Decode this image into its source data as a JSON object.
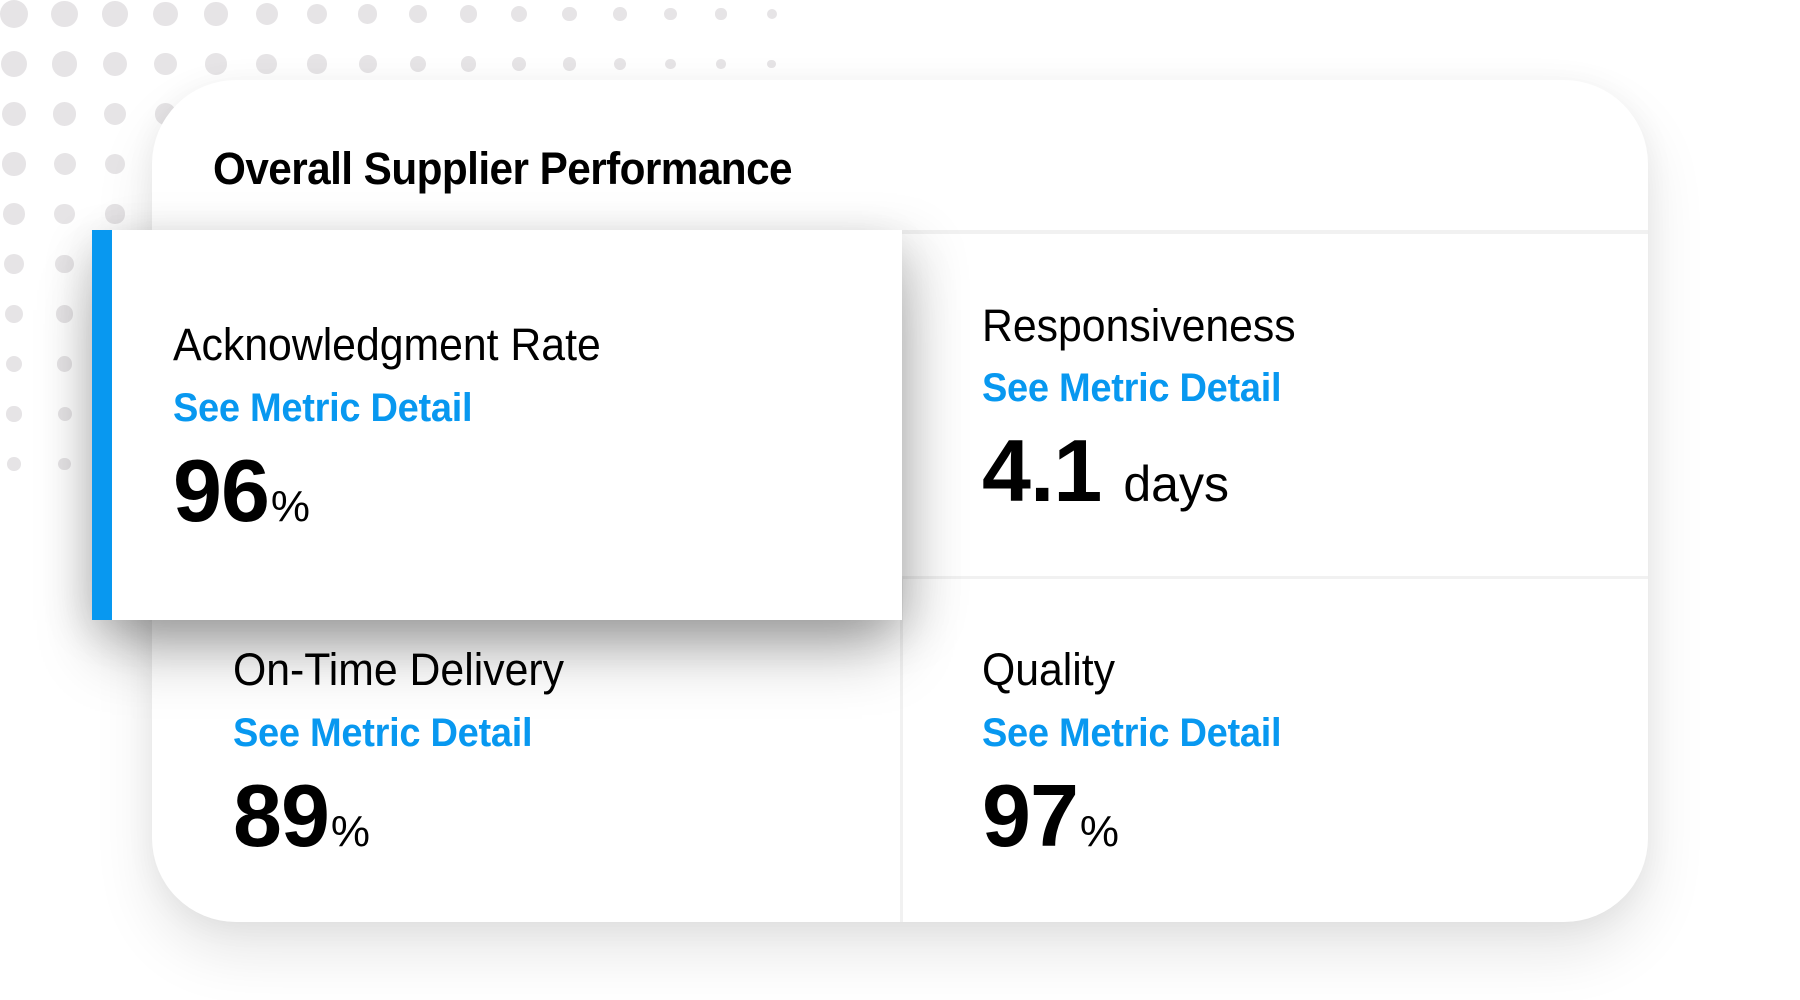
{
  "colors": {
    "accent": "#0898f0",
    "text": "#000000",
    "dots": "#e6e4e6",
    "divider": "#f1f1f1"
  },
  "card": {
    "title": "Overall Supplier Performance"
  },
  "metrics": [
    {
      "id": "acknowledgment-rate",
      "label": "Acknowledgment Rate",
      "link": "See Metric Detail",
      "value": "96",
      "unit": "%",
      "highlighted": true
    },
    {
      "id": "responsiveness",
      "label": "Responsiveness",
      "link": "See Metric Detail",
      "value": "4.1",
      "unit": "days",
      "highlighted": false
    },
    {
      "id": "on-time-delivery",
      "label": "On-Time Delivery",
      "link": "See Metric Detail",
      "value": "89",
      "unit": "%",
      "highlighted": false
    },
    {
      "id": "quality",
      "label": "Quality",
      "link": "See Metric Detail",
      "value": "97",
      "unit": "%",
      "highlighted": false
    }
  ]
}
